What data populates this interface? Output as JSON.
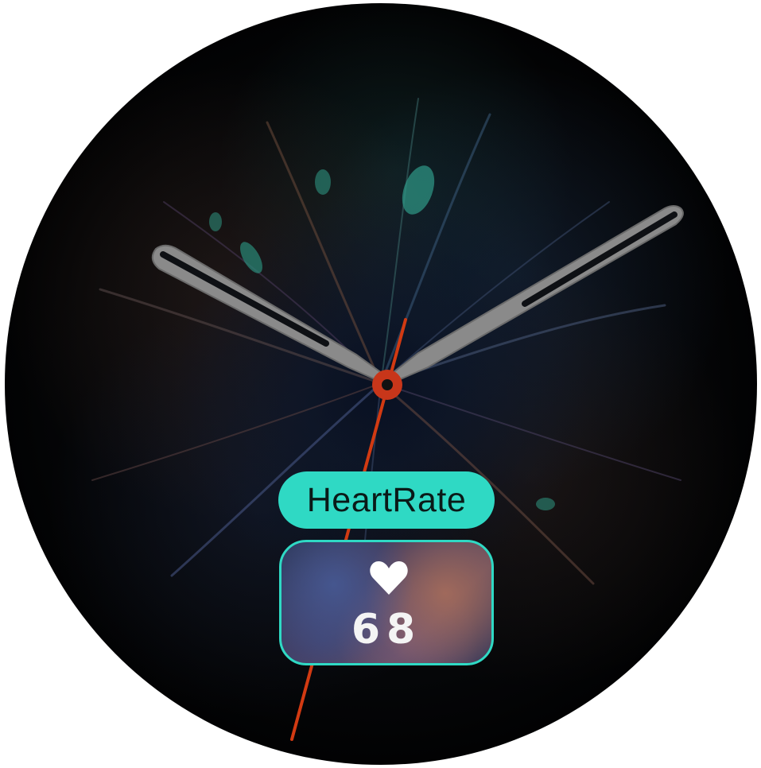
{
  "complication": {
    "label": "HeartRate",
    "icon": "heart-icon",
    "value": "68"
  },
  "colors": {
    "accent": "#2fd9c4",
    "second_hand": "#d23a12",
    "hand_gray": "#8c8c8c"
  }
}
